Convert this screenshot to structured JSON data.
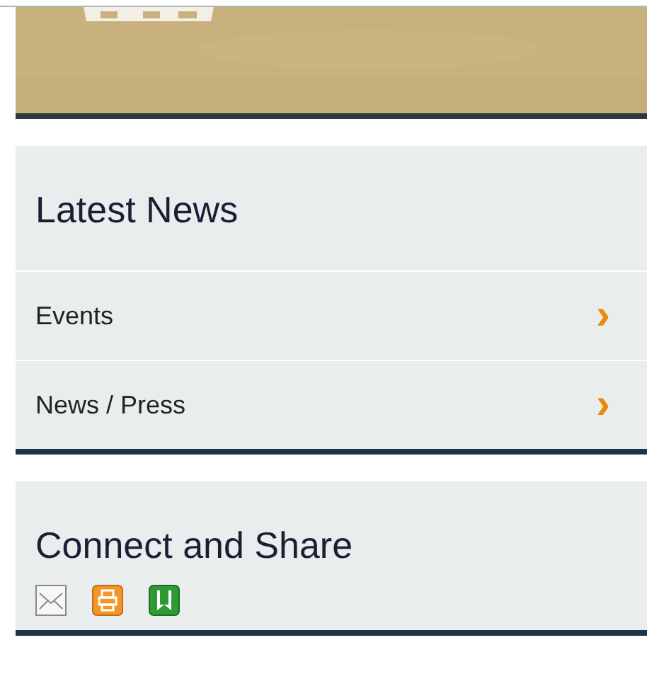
{
  "latest_news": {
    "title": "Latest News",
    "items": [
      {
        "label": "Events",
        "arrow": "›"
      },
      {
        "label": "News / Press",
        "arrow": "›"
      }
    ]
  },
  "connect": {
    "title": "Connect and Share",
    "icons": [
      {
        "kind": "email"
      },
      {
        "kind": "print"
      },
      {
        "kind": "bookmark"
      }
    ]
  }
}
